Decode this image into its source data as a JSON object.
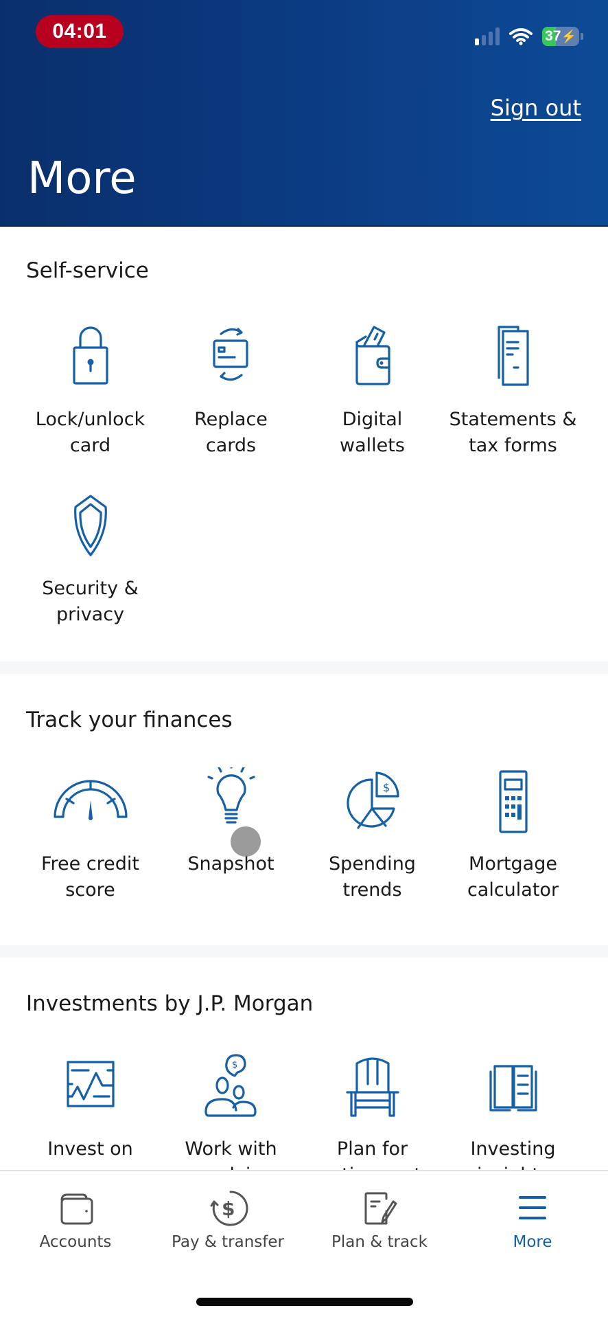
{
  "status_bar": {
    "time": "04:01",
    "battery_percent": 37,
    "battery_label": "37",
    "signal_bars_active": 1,
    "signal_bars_total": 4,
    "icons": [
      "cellular-signal-icon",
      "wifi-icon",
      "battery-charging-icon"
    ]
  },
  "header": {
    "title": "More",
    "sign_out_label": "Sign out"
  },
  "colors": {
    "header_dark": "#0a2f6c",
    "header_light": "#0d4a96",
    "accent": "#1660a8",
    "time_badge": "#b8001f",
    "battery_fill": "#35c759"
  },
  "sections": [
    {
      "title": "Self-service",
      "items": [
        {
          "line1": "Lock/unlock",
          "line2": "card",
          "icon": "lock-icon"
        },
        {
          "line1": "Replace",
          "line2": "cards",
          "icon": "replace-card-icon"
        },
        {
          "line1": "Digital",
          "line2": "wallets",
          "icon": "wallet-icon"
        },
        {
          "line1": "Statements &",
          "line2": "tax forms",
          "icon": "documents-icon"
        },
        {
          "line1": "Security &",
          "line2": "privacy",
          "icon": "shield-icon"
        }
      ]
    },
    {
      "title": "Track your finances",
      "items": [
        {
          "line1": "Free credit",
          "line2": "score",
          "icon": "gauge-icon"
        },
        {
          "line1": "Snapshot",
          "line2": "",
          "icon": "lightbulb-icon"
        },
        {
          "line1": "Spending",
          "line2": "trends",
          "icon": "pie-chart-icon"
        },
        {
          "line1": "Mortgage",
          "line2": "calculator",
          "icon": "calculator-icon"
        }
      ]
    },
    {
      "title": "Investments by J.P. Morgan",
      "items": [
        {
          "line1": "Invest on",
          "line2": "your own",
          "icon": "stock-chart-icon"
        },
        {
          "line1": "Work with",
          "line2": "an advisor",
          "icon": "advisor-icon"
        },
        {
          "line1": "Plan for",
          "line2": "retirement",
          "icon": "chair-icon"
        },
        {
          "line1": "Investing",
          "line2": "insights",
          "icon": "book-icon"
        }
      ]
    }
  ],
  "tabbar": {
    "tabs": [
      {
        "label": "Accounts",
        "icon": "wallet-icon",
        "active": false
      },
      {
        "label": "Pay & transfer",
        "icon": "dollar-transfer-icon",
        "active": false
      },
      {
        "label": "Plan & track",
        "icon": "notepad-pencil-icon",
        "active": false
      },
      {
        "label": "More",
        "icon": "menu-icon",
        "active": true
      }
    ]
  }
}
